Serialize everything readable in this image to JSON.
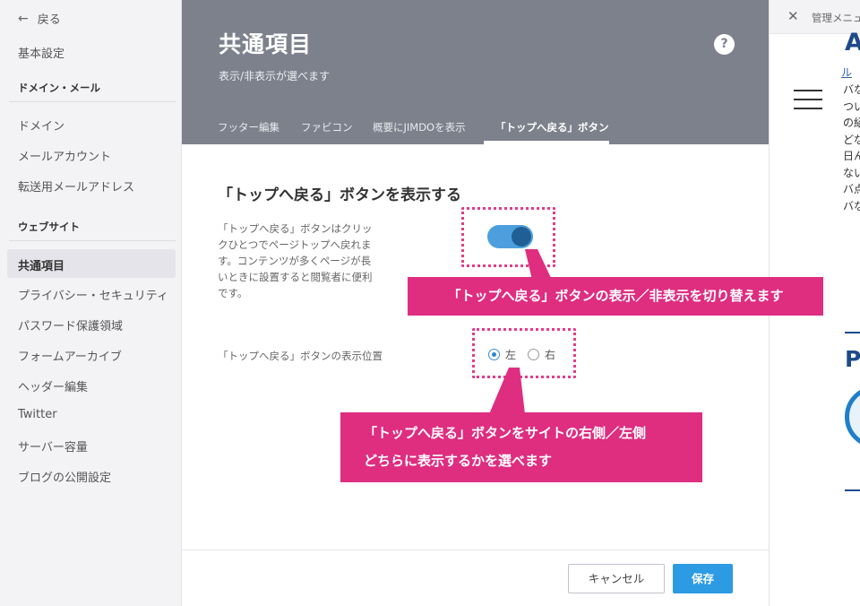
{
  "sidebar": {
    "back_label": "戻る",
    "items": [
      {
        "label": "基本設定"
      },
      {
        "label": "ドメイン・メール"
      },
      {
        "label": "ドメイン"
      },
      {
        "label": "メールアカウント"
      },
      {
        "label": "転送用メールアドレス"
      },
      {
        "label": "ウェブサイト"
      },
      {
        "label": "共通項目"
      },
      {
        "label": "プライバシー・セキュリティ"
      },
      {
        "label": "パスワード保護領域"
      },
      {
        "label": "フォームアーカイブ"
      },
      {
        "label": "ヘッダー編集"
      },
      {
        "label": "Twitter"
      },
      {
        "label": "サーバー容量"
      },
      {
        "label": "ブログの公開設定"
      }
    ],
    "active_item": "共通項目"
  },
  "header": {
    "title": "共通項目",
    "subtitle": "表示/非表示が選べます",
    "help_glyph": "?",
    "tabs": [
      {
        "label": "フッター編集"
      },
      {
        "label": "ファビコン"
      },
      {
        "label": "概要にJIMDOを表示"
      },
      {
        "label": "「トップへ戻る」ボタン"
      }
    ],
    "active_tab": "「トップへ戻る」ボタン"
  },
  "content": {
    "section_title": "「トップへ戻る」ボタンを表示する",
    "description": "「トップへ戻る」ボタンはクリックひとつでページトップへ戻れます。コンテンツが多くページが長いときに設置すると閲覧者に便利です。",
    "toggle_on": true,
    "position_label": "「トップへ戻る」ボタンの表示位置",
    "radio_options": [
      "左",
      "右"
    ],
    "radio_selected": "左"
  },
  "footer": {
    "cancel_label": "キャンセル",
    "save_label": "保存"
  },
  "preview": {
    "close_glyph": "✕",
    "admin_label": "管理メニュー",
    "letter_a": "A",
    "link_text": "ル",
    "text_chars": "バなついの紹どな日んないバ点バな",
    "letter_p": "P"
  },
  "annotations": {
    "callout1": "「トップへ戻る」ボタンの表示／非表示を切り替えます",
    "callout2_line1": "「トップへ戻る」ボタンをサイトの右側／左側",
    "callout2_line2": "どちらに表示するかを選べます"
  },
  "colors": {
    "header_bg": "#7d818c",
    "sidebar_bg": "#f3f3f6",
    "accent_blue": "#2c9be3",
    "toggle_on": "#4c9fdc",
    "annotation_pink": "#df2d80"
  }
}
